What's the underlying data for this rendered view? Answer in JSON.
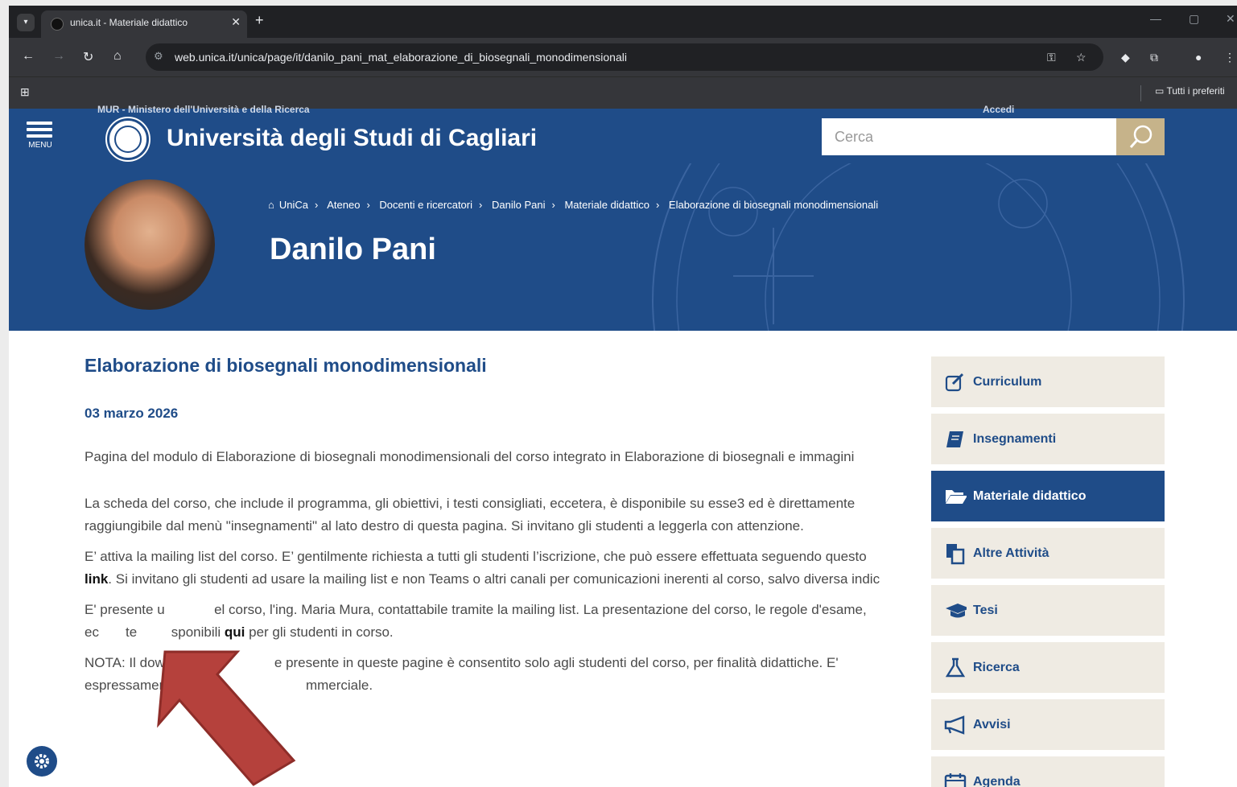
{
  "browser": {
    "tab_title": "unica.it - Materiale didattico",
    "tab_close": "✕",
    "new_tab": "+",
    "url": "web.unica.it/unica/page/it/danilo_pani_mat_elaborazione_di_biosegnali_monodimensionali",
    "bookmarks_folder": "Tutti i preferiti"
  },
  "header": {
    "ministry": "MUR - Ministero dell'Università e della Ricerca",
    "accedi": "Accedi",
    "menu_label": "MENU",
    "site_title": "Università degli Studi di Cagliari",
    "search_placeholder": "Cerca"
  },
  "hero": {
    "breadcrumb": [
      "UniCa",
      "Ateneo",
      "Docenti e ricercatori",
      "Danilo Pani",
      "Materiale didattico",
      "Elaborazione di biosegnali monodimensionali"
    ],
    "name": "Danilo Pani"
  },
  "article": {
    "title": "Elaborazione di biosegnali monodimensionali",
    "date": "03 marzo 2026",
    "p1": "Pagina del modulo di Elaborazione di biosegnali monodimensionali del corso integrato in Elaborazione di biosegnali e immagini",
    "p2": "La scheda del corso, che include il programma, gli obiettivi, i testi consigliati, eccetera, è disponibile su esse3 ed è direttamente raggiungibile dal menù \"insegnamenti\" al lato destro di questa pagina. Si invitano gli studenti a leggerla con attenzione.",
    "p3_a": "E’ attiva la mailing list del corso. E’ gentilmente richiesta a tutti gli studenti l’iscrizione, che può essere effettuata seguendo questo ",
    "p3_link": "link",
    "p3_b": ". Si invitano gli studenti ad usare la mailing list e non Teams o altri canali per comunicazioni inerenti al corso, salvo diversa indic",
    "p4_a": "E' presente u",
    "p4_b": "el corso, l'ing. Maria Mura, contattabile tramite la mailing list. La presentazione del corso, le regole d'esame, ec",
    "p4_c": "te",
    "p4_d": "sponibili ",
    "p4_link": "qui",
    "p4_e": " per gli studenti in corso.",
    "p5_a": "NOTA: Il download d",
    "p5_b": "e presente in queste pagine è consentito solo agli studenti del corso, per finalità didattiche. E' espressamente vietato",
    "p5_c": "mmerciale."
  },
  "sidebar": {
    "items": [
      {
        "label": "Curriculum",
        "icon": "edit-icon"
      },
      {
        "label": "Insegnamenti",
        "icon": "book-icon"
      },
      {
        "label": "Materiale didattico",
        "icon": "folder-open-icon",
        "active": true
      },
      {
        "label": "Altre Attività",
        "icon": "copy-icon"
      },
      {
        "label": "Tesi",
        "icon": "graduation-cap-icon"
      },
      {
        "label": "Ricerca",
        "icon": "flask-icon"
      },
      {
        "label": "Avvisi",
        "icon": "megaphone-icon"
      },
      {
        "label": "Agenda",
        "icon": "calendar-icon"
      }
    ]
  },
  "colors": {
    "brand_blue": "#1f4c88",
    "accent_gold": "#c6b38a",
    "sidebar_bg": "#efebe3",
    "arrow_red": "#b5413c"
  }
}
